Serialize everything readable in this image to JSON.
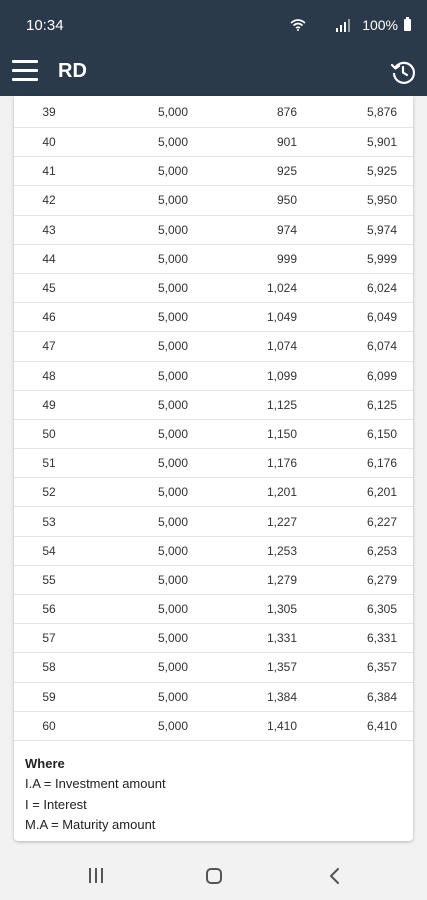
{
  "status": {
    "time": "10:34",
    "battery": "100%"
  },
  "appbar": {
    "title": "RD"
  },
  "table": {
    "rows": [
      [
        "39",
        "5,000",
        "876",
        "5,876"
      ],
      [
        "40",
        "5,000",
        "901",
        "5,901"
      ],
      [
        "41",
        "5,000",
        "925",
        "5,925"
      ],
      [
        "42",
        "5,000",
        "950",
        "5,950"
      ],
      [
        "43",
        "5,000",
        "974",
        "5,974"
      ],
      [
        "44",
        "5,000",
        "999",
        "5,999"
      ],
      [
        "45",
        "5,000",
        "1,024",
        "6,024"
      ],
      [
        "46",
        "5,000",
        "1,049",
        "6,049"
      ],
      [
        "47",
        "5,000",
        "1,074",
        "6,074"
      ],
      [
        "48",
        "5,000",
        "1,099",
        "6,099"
      ],
      [
        "49",
        "5,000",
        "1,125",
        "6,125"
      ],
      [
        "50",
        "5,000",
        "1,150",
        "6,150"
      ],
      [
        "51",
        "5,000",
        "1,176",
        "6,176"
      ],
      [
        "52",
        "5,000",
        "1,201",
        "6,201"
      ],
      [
        "53",
        "5,000",
        "1,227",
        "6,227"
      ],
      [
        "54",
        "5,000",
        "1,253",
        "6,253"
      ],
      [
        "55",
        "5,000",
        "1,279",
        "6,279"
      ],
      [
        "56",
        "5,000",
        "1,305",
        "6,305"
      ],
      [
        "57",
        "5,000",
        "1,331",
        "6,331"
      ],
      [
        "58",
        "5,000",
        "1,357",
        "6,357"
      ],
      [
        "59",
        "5,000",
        "1,384",
        "6,384"
      ],
      [
        "60",
        "5,000",
        "1,410",
        "6,410"
      ]
    ]
  },
  "legend": {
    "heading": "Where",
    "lines": [
      "I.A = Investment amount",
      "I = Interest",
      "M.A = Maturity amount"
    ]
  },
  "icons": {
    "menu": "menu-icon",
    "history": "history-icon",
    "wifi": "wifi-icon",
    "signal": "signal-icon",
    "battery": "battery-icon",
    "recents": "recents-icon",
    "home": "home-icon",
    "back": "back-icon"
  }
}
